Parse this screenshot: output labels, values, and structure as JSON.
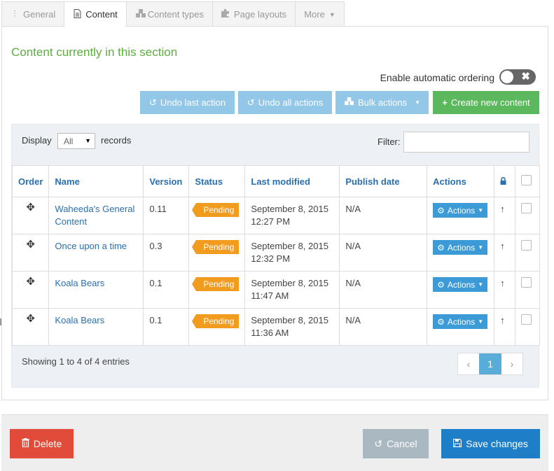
{
  "tabs": [
    {
      "label": "General",
      "icon": "sliders-icon"
    },
    {
      "label": "Content",
      "icon": "document-icon"
    },
    {
      "label": "Content types",
      "icon": "cubes-icon"
    },
    {
      "label": "Page layouts",
      "icon": "puzzle-icon"
    },
    {
      "label": "More",
      "icon": "caret-down-icon"
    }
  ],
  "section": {
    "title": "Content currently in this section"
  },
  "ordering": {
    "label": "Enable automatic ordering",
    "enabled": false
  },
  "toolbar": {
    "undo_last": "Undo last action",
    "undo_all": "Undo all actions",
    "bulk": "Bulk actions",
    "create": "Create new content"
  },
  "table_controls": {
    "display_label": "Display",
    "display_value": "All",
    "records_label": "records",
    "filter_label": "Filter:",
    "filter_value": ""
  },
  "columns": [
    "Order",
    "Name",
    "Version",
    "Status",
    "Last modified",
    "Publish date",
    "Actions"
  ],
  "rows": [
    {
      "name": "Waheeda's General Content",
      "version": "0.11",
      "status": "Pending",
      "modified_date": "September 8, 2015",
      "modified_time": "12:27 PM",
      "publish": "N/A",
      "action": "Actions"
    },
    {
      "name": "Once upon a time",
      "version": "0.3",
      "status": "Pending",
      "modified_date": "September 8, 2015",
      "modified_time": "12:32 PM",
      "publish": "N/A",
      "action": "Actions"
    },
    {
      "name": "Koala Bears",
      "version": "0.1",
      "status": "Pending",
      "modified_date": "September 8, 2015",
      "modified_time": "11:47 AM",
      "publish": "N/A",
      "action": "Actions"
    },
    {
      "name": "Koala Bears",
      "version": "0.1",
      "status": "Pending",
      "modified_date": "September 8, 2015",
      "modified_time": "11:36 AM",
      "publish": "N/A",
      "action": "Actions"
    }
  ],
  "pagination": {
    "summary": "Showing 1 to 4 of 4 entries",
    "prev": "‹",
    "current": "1",
    "next": "›"
  },
  "footer": {
    "delete": "Delete",
    "cancel": "Cancel",
    "save": "Save changes"
  },
  "colors": {
    "accent_green": "#5cad3e",
    "link_blue": "#2a6fae",
    "pending_orange": "#f29c1f",
    "delete_red": "#e04b3a",
    "save_blue": "#1e7fc8"
  }
}
